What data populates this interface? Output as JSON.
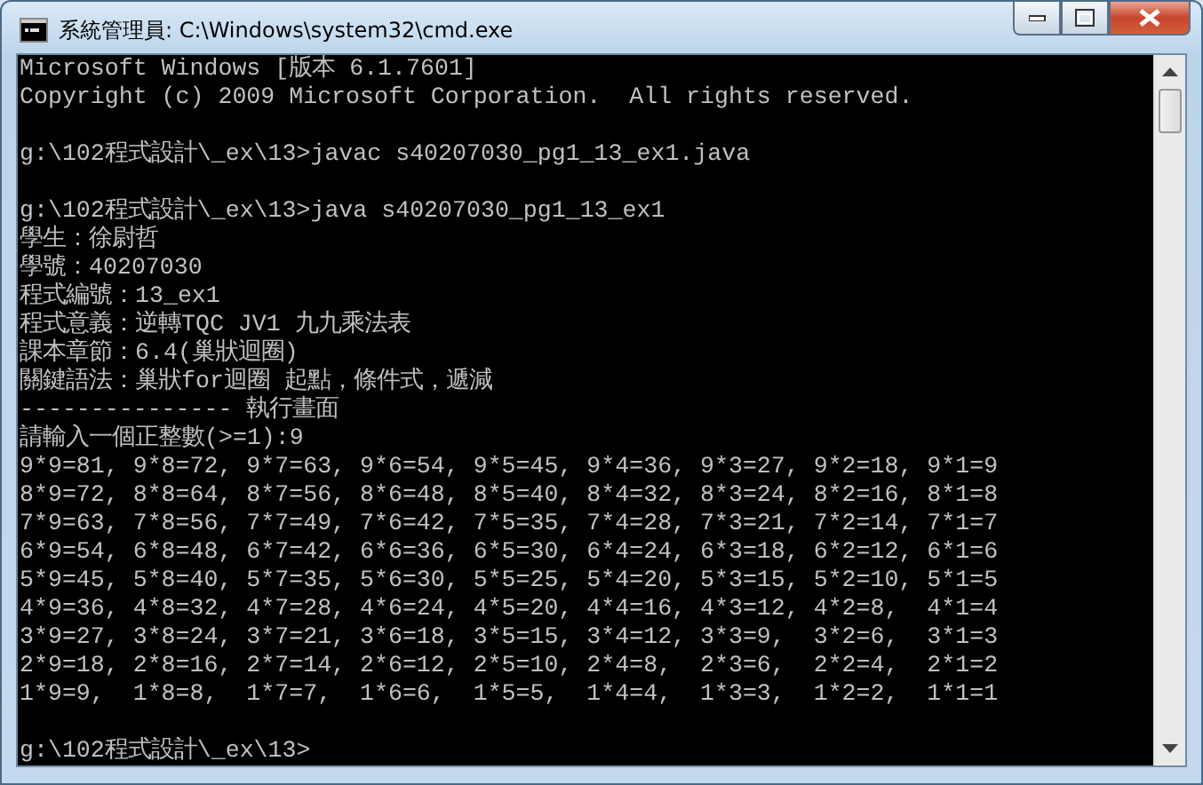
{
  "window": {
    "title": "系統管理員: C:\\Windows\\system32\\cmd.exe"
  },
  "console": {
    "lines": [
      {
        "kind": "text",
        "text": "Microsoft Windows [版本 6.1.7601]"
      },
      {
        "kind": "text",
        "text": "Copyright (c) 2009 Microsoft Corporation.  All rights reserved."
      },
      {
        "kind": "blank"
      },
      {
        "kind": "text",
        "text": "g:\\102程式設計\\_ex\\13>javac s40207030_pg1_13_ex1.java"
      },
      {
        "kind": "blank"
      },
      {
        "kind": "text",
        "text": "g:\\102程式設計\\_ex\\13>java s40207030_pg1_13_ex1"
      },
      {
        "kind": "text",
        "text": "學生：徐尉哲"
      },
      {
        "kind": "text",
        "text": "學號：40207030"
      },
      {
        "kind": "text",
        "text": "程式編號：13_ex1"
      },
      {
        "kind": "text",
        "text": "程式意義：逆轉TQC JV1 九九乘法表"
      },
      {
        "kind": "text",
        "text": "課本章節：6.4(巢狀迴圈)"
      },
      {
        "kind": "text",
        "text": "關鍵語法：巢狀for迴圈 起點，條件式，遞減"
      },
      {
        "kind": "text",
        "text": "--------------- 執行畫面"
      },
      {
        "kind": "text",
        "text": "請輸入一個正整數(>=1):9"
      },
      {
        "kind": "text",
        "text": "9*9=81, 9*8=72, 9*7=63, 9*6=54, 9*5=45, 9*4=36, 9*3=27, 9*2=18, 9*1=9"
      },
      {
        "kind": "text",
        "text": "8*9=72, 8*8=64, 8*7=56, 8*6=48, 8*5=40, 8*4=32, 8*3=24, 8*2=16, 8*1=8"
      },
      {
        "kind": "text",
        "text": "7*9=63, 7*8=56, 7*7=49, 7*6=42, 7*5=35, 7*4=28, 7*3=21, 7*2=14, 7*1=7"
      },
      {
        "kind": "text",
        "text": "6*9=54, 6*8=48, 6*7=42, 6*6=36, 6*5=30, 6*4=24, 6*3=18, 6*2=12, 6*1=6"
      },
      {
        "kind": "text",
        "text": "5*9=45, 5*8=40, 5*7=35, 5*6=30, 5*5=25, 5*4=20, 5*3=15, 5*2=10, 5*1=5"
      },
      {
        "kind": "text",
        "text": "4*9=36, 4*8=32, 4*7=28, 4*6=24, 4*5=20, 4*4=16, 4*3=12, 4*2=8,  4*1=4"
      },
      {
        "kind": "text",
        "text": "3*9=27, 3*8=24, 3*7=21, 3*6=18, 3*5=15, 3*4=12, 3*3=9,  3*2=6,  3*1=3"
      },
      {
        "kind": "text",
        "text": "2*9=18, 2*8=16, 2*7=14, 2*6=12, 2*5=10, 2*4=8,  2*3=6,  2*2=4,  2*1=2"
      },
      {
        "kind": "text",
        "text": "1*9=9,  1*8=8,  1*7=7,  1*6=6,  1*5=5,  1*4=4,  1*3=3,  1*2=2,  1*1=1"
      },
      {
        "kind": "blank"
      },
      {
        "kind": "text",
        "text": "g:\\102程式設計\\_ex\\13>"
      }
    ]
  }
}
